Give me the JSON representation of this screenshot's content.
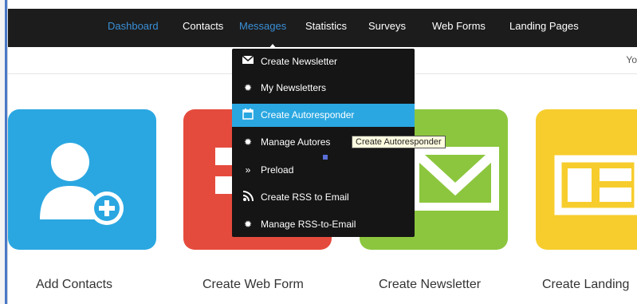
{
  "nav": {
    "items": [
      {
        "label": "Dashboard"
      },
      {
        "label": "Contacts"
      },
      {
        "label": "Messages"
      },
      {
        "label": "Statistics"
      },
      {
        "label": "Surveys"
      },
      {
        "label": "Web Forms"
      },
      {
        "label": "Landing Pages"
      }
    ],
    "active": "Messages",
    "active_color": "#3a8fd6"
  },
  "subbar": {
    "user_text": "Yo"
  },
  "dropdown": {
    "items": [
      {
        "label": "Create Newsletter",
        "icon": "envelope-icon"
      },
      {
        "label": "My Newsletters",
        "icon": "gear-icon"
      },
      {
        "label": "Create Autoresponder",
        "icon": "calendar-icon"
      },
      {
        "label": "Manage Autores",
        "icon": "gear-icon"
      },
      {
        "label": "Preload",
        "icon": "double-chevron-icon"
      },
      {
        "label": "Create RSS to Email",
        "icon": "rss-icon"
      },
      {
        "label": "Manage RSS-to-Email",
        "icon": "gear-icon"
      }
    ],
    "highlighted": "Create Autoresponder",
    "highlight_color": "#2aa7e1"
  },
  "tooltip": "Create Autoresponder",
  "tiles": [
    {
      "label": "Add Contacts",
      "color": "#2aa7e1",
      "icon": "add-user-icon"
    },
    {
      "label": "Create Web Form",
      "color": "#e54b3d",
      "icon": "web-form-icon"
    },
    {
      "label": "Create Newsletter",
      "color": "#8cc63e",
      "icon": "envelope-icon"
    },
    {
      "label": "Create Landing",
      "color": "#f7cd2d",
      "icon": "landing-page-icon"
    }
  ]
}
